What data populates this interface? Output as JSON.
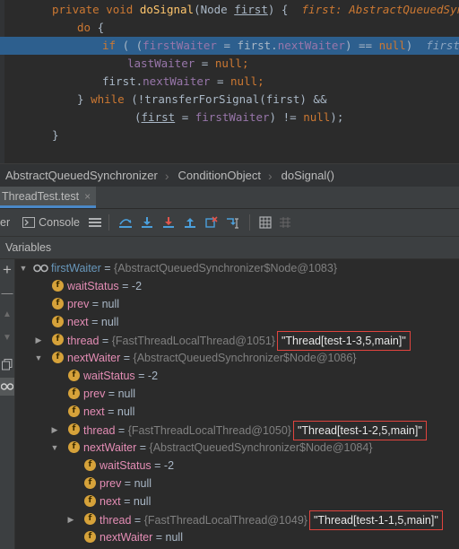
{
  "editor": {
    "lines": [
      {
        "a": "private ",
        "b": "void ",
        "c": "doSignal",
        "d": "(Node ",
        "e": "first",
        "f": ") {  ",
        "g": "first: AbstractQueuedSynchro"
      },
      {
        "a": "do",
        "b": " {"
      },
      {
        "a": "if",
        "b": " ( (",
        "c": "firstWaiter",
        "d": " = first.",
        "e": "nextWaiter",
        "f": ") == ",
        "g": "null",
        "h": ")  ",
        "i": "firstWait"
      },
      {
        "a": "lastWaiter",
        "b": " = ",
        "c": "null",
        "d": ";"
      },
      {
        "a": "first.",
        "b": "nextWaiter",
        "c": " = ",
        "d": "null",
        "e": ";"
      },
      {
        "a": "} ",
        "b": "while",
        "c": " (!transferForSignal(first) &&"
      },
      {
        "a": "(",
        "b": "first",
        "c": " = ",
        "d": "firstWaiter",
        "e": ") != ",
        "f": "null",
        "g": ");"
      },
      {
        "a": "}"
      }
    ]
  },
  "breadcrumb": [
    "AbstractQueuedSynchronizer",
    "ConditionObject",
    "doSignal()"
  ],
  "tab": {
    "label": "ThreadTest.test",
    "close": "×"
  },
  "toolbar": {
    "debugger_label": "er",
    "console_label": "Console"
  },
  "variables_header": "Variables",
  "tree": [
    {
      "name": "firstWaiter",
      "eq": " = ",
      "type": "{AbstractQueuedSynchronizer$Node@1083}",
      "val": "",
      "str": ""
    },
    {
      "name": "waitStatus",
      "eq": " = ",
      "type": "",
      "val": "-2",
      "str": ""
    },
    {
      "name": "prev",
      "eq": " = ",
      "type": "",
      "val": "null",
      "str": ""
    },
    {
      "name": "next",
      "eq": " = ",
      "type": "",
      "val": "null",
      "str": ""
    },
    {
      "name": "thread",
      "eq": " = ",
      "type": "{FastThreadLocalThread@1051}",
      "val": "",
      "str": "\"Thread[test-1-3,5,main]\""
    },
    {
      "name": "nextWaiter",
      "eq": " = ",
      "type": "{AbstractQueuedSynchronizer$Node@1086}",
      "val": "",
      "str": ""
    },
    {
      "name": "waitStatus",
      "eq": " = ",
      "type": "",
      "val": "-2",
      "str": ""
    },
    {
      "name": "prev",
      "eq": " = ",
      "type": "",
      "val": "null",
      "str": ""
    },
    {
      "name": "next",
      "eq": " = ",
      "type": "",
      "val": "null",
      "str": ""
    },
    {
      "name": "thread",
      "eq": " = ",
      "type": "{FastThreadLocalThread@1050}",
      "val": "",
      "str": "\"Thread[test-1-2,5,main]\""
    },
    {
      "name": "nextWaiter",
      "eq": " = ",
      "type": "{AbstractQueuedSynchronizer$Node@1084}",
      "val": "",
      "str": ""
    },
    {
      "name": "waitStatus",
      "eq": " = ",
      "type": "",
      "val": "-2",
      "str": ""
    },
    {
      "name": "prev",
      "eq": " = ",
      "type": "",
      "val": "null",
      "str": ""
    },
    {
      "name": "next",
      "eq": " = ",
      "type": "",
      "val": "null",
      "str": ""
    },
    {
      "name": "thread",
      "eq": " = ",
      "type": "{FastThreadLocalThread@1049}",
      "val": "",
      "str": "\"Thread[test-1-1,5,main]\""
    },
    {
      "name": "nextWaiter",
      "eq": " = ",
      "type": "",
      "val": "null",
      "str": ""
    }
  ],
  "icons": {
    "field": "f",
    "watch": "glasses-icon",
    "expanded": "▼",
    "collapsed": "▶"
  },
  "colors": {
    "highlight_line": "#2d5f8e",
    "string_box_border": "#e0443e",
    "field_icon": "#d6a23a",
    "active_tab_underline": "#4a88c7"
  }
}
